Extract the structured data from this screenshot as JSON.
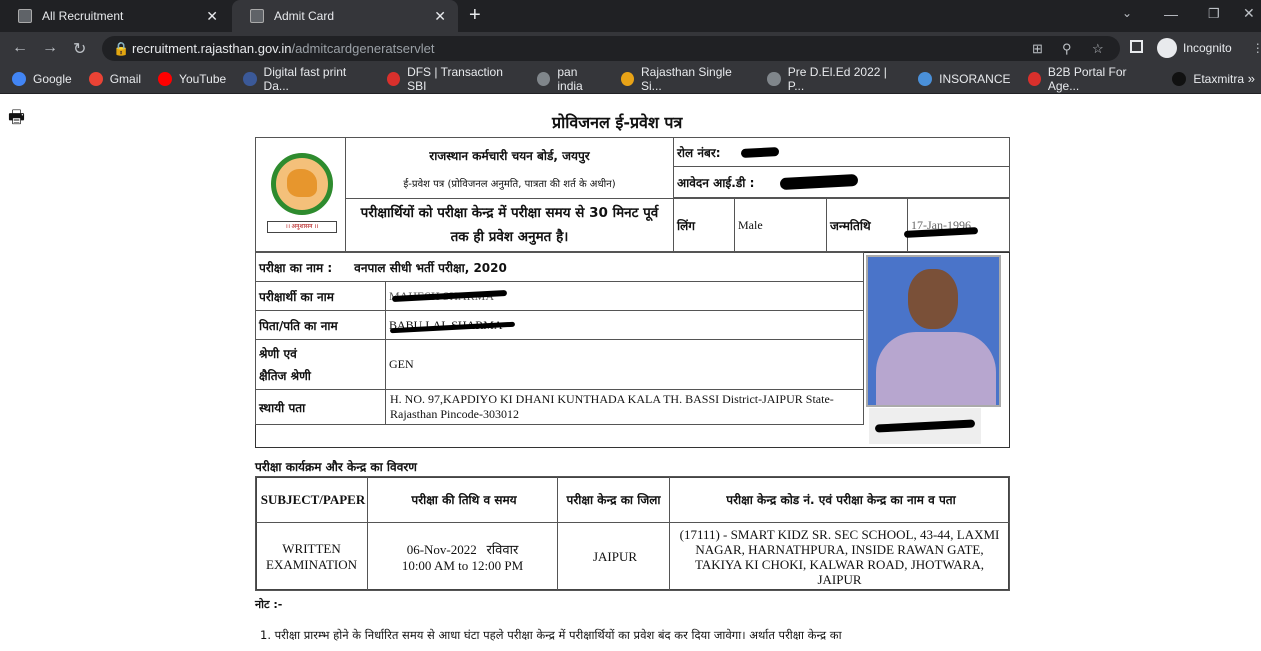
{
  "browser": {
    "tabs": [
      {
        "label": "All Recruitment",
        "active": false
      },
      {
        "label": "Admit Card",
        "active": true
      }
    ],
    "url_host": "recruitment.rajasthan.gov.in",
    "url_path": "/admitcardgeneratservlet",
    "profile": "Incognito",
    "bookmarks": [
      {
        "label": "Google",
        "color": "#4285f4"
      },
      {
        "label": "Gmail",
        "color": "#ea4335"
      },
      {
        "label": "YouTube",
        "color": "#ff0000"
      },
      {
        "label": "Digital fast print Da...",
        "color": "#3b5998"
      },
      {
        "label": "DFS | Transaction SBI",
        "color": "#d9302c"
      },
      {
        "label": "pan india",
        "color": "#80868b"
      },
      {
        "label": "Rajasthan Single Si...",
        "color": "#e8a317"
      },
      {
        "label": "Pre D.El.Ed 2022 | P...",
        "color": "#80868b"
      },
      {
        "label": "INSORANCE",
        "color": "#4a90d9"
      },
      {
        "label": "B2B Portal For Age...",
        "color": "#d9302c"
      },
      {
        "label": "Etaxmitra",
        "color": "#111"
      }
    ],
    "more": "»"
  },
  "doc": {
    "title": "प्रोविजनल ई-प्रवेश पत्र",
    "board": "राजस्थान कर्मचारी चयन बोर्ड, जयपुर",
    "subtitle": "ई-प्रवेश पत्र (प्रोविजनल अनुमति, पात्रता की शर्त के अधीन)",
    "entry_notice": "परीक्षार्थियों को परीक्षा केन्द्र में परीक्षा समय से 30 मिनट पूर्व तक ही प्रवेश अनुमत है।",
    "roll_label": "रोल नंबर:",
    "app_id_label": "आवेदन आई.डी :",
    "gender_label": "लिंग",
    "gender": "Male",
    "dob_label": "जन्मतिथि",
    "dob": "17-Jan-1996",
    "logo_text": "।। अनुशासन ।।",
    "exam_label": "परीक्षा का नाम :",
    "exam": "वनपाल सीधी भर्ती परीक्षा, 2020",
    "name_label": "परीक्षार्थी का नाम",
    "name": "MAHESH SHARMA",
    "father_label": "पिता/पति का नाम",
    "father": "BABU LAL SHARMA",
    "category_label_1": "श्रेणी एवं",
    "category_label_2": "क्षैतिज श्रेणी",
    "category": "GEN",
    "address_label": "स्थायी पता",
    "address": "H. NO. 97,KAPDIYO KI DHANI KUNTHADA KALA TH. BASSI District-JAIPUR State-Rajasthan Pincode-303012",
    "schedule_heading": "परीक्षा कार्यक्रम और केन्द्र का विवरण",
    "table_headers": [
      "SUBJECT/PAPER",
      "परीक्षा की तिथि व समय",
      "परीक्षा केन्द्र का जिला",
      "परीक्षा केन्द्र कोड नं. एवं परीक्षा केन्द्र का नाम व पता"
    ],
    "row": {
      "subject": "WRITTEN EXAMINATION",
      "date": "06-Nov-2022   रविवार",
      "time": "10:00 AM to 12:00 PM",
      "district": "JAIPUR",
      "center": "(17111) - SMART KIDZ SR. SEC SCHOOL, 43-44, LAXMI NAGAR, HARNATHPURA, INSIDE RAWAN GATE, TAKIYA KI CHOKI, KALWAR ROAD, JHOTWARA, JAIPUR"
    },
    "note_label": "नोट :-",
    "note_1": "1. परीक्षा प्रारम्भ होने के निर्धारित समय  से आधा घंटा पहले परीक्षा केन्द्र में परीक्षार्थियों का प्रवेश बंद कर दिया जावेगा। अर्थात परीक्षा केन्द्र का"
  }
}
